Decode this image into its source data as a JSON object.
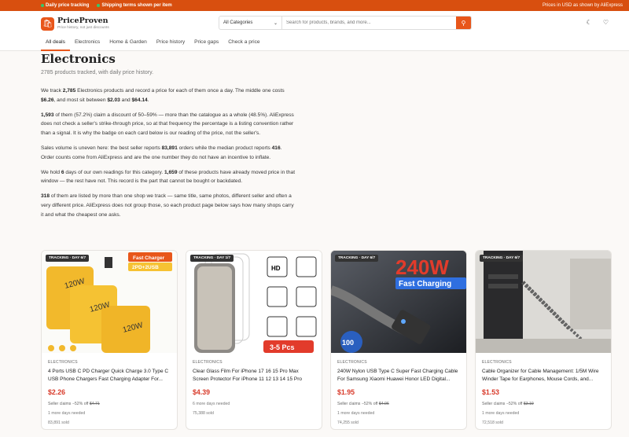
{
  "topbar": {
    "left": [
      "Daily price tracking",
      "Shipping terms shown per item"
    ],
    "right": "Prices in USD as shown by AliExpress"
  },
  "brand": {
    "name": "PriceProven",
    "tagline": "Price history, not just discounts"
  },
  "search": {
    "category": "All Categories",
    "placeholder": "Search for products, brands, and more..."
  },
  "nav": [
    "All deals",
    "Electronics",
    "Home & Garden",
    "Price history",
    "Price gaps",
    "Check a price"
  ],
  "page": {
    "title": "Electronics",
    "subtitle": "2785 products tracked, with daily price history."
  },
  "paragraphs": {
    "p1": {
      "a": "We track ",
      "b1": "2,785",
      "c": " Electronics products and record a price for each of them once a day. The middle one costs ",
      "b2": "$6.26",
      "d": ", and most sit between ",
      "b3": "$2.03",
      "e": " and ",
      "b4": "$64.14",
      "f": "."
    },
    "p2": {
      "b1": "1,593",
      "a": " of them (57.2%) claim a discount of 50–59% — more than the catalogue as a whole (48.5%). AliExpress does not check a seller's strike-through price, so at that frequency the percentage is a listing convention rather than a signal. It is why the badge on each card below is our reading of the price, not the seller's."
    },
    "p3": {
      "a": "Sales volume is uneven here: the best seller reports ",
      "b1": "83,891",
      "c": " orders while the median product reports ",
      "b2": "416",
      "d": ". Order counts come from AliExpress and are the one number they do not have an incentive to inflate."
    },
    "p4": {
      "a": "We hold ",
      "b1": "6",
      "c": " days of our own readings for this category. ",
      "b2": "1,659",
      "d": " of these products have already moved price in that window — the rest have not. This record is the part that cannot be bought or backdated."
    },
    "p5": {
      "b1": "318",
      "a": " of them are listed by more than one shop we track — same title, same photos, different seller and often a very different price. AliExpress does not group those, so each product page below says how many shops carry it and what the cheapest one asks."
    }
  },
  "cards": [
    {
      "badge": "TRACKING · DAY 6/7",
      "category": "ELECTRONICS",
      "title": "4 Ports USB C PD Charger Quick Charge 3.0 Type C USB Phone Chargers Fast Charging Adapter For...",
      "price": "$2.26",
      "claim_prefix": "Seller claims −52% off ",
      "claim_was": "$4.71",
      "days": "1 more days needed",
      "sold": "83,891 sold",
      "img_text1": "Fast Charger",
      "img_text2": "2PD+2USB",
      "img_text3": "120W"
    },
    {
      "badge": "TRACKING · DAY 1/7",
      "category": "ELECTRONICS",
      "title": "Clear Glass Film For iPhone 17 16 15 Pro Max Screen Protector For iPhone 11 12 13 14 15 Pro Tempered...",
      "price": "$4.39",
      "claim_prefix": "",
      "claim_was": "",
      "days": "6 more days needed",
      "sold": "75,388 sold",
      "img_text1": "HD",
      "img_text2": "3-5 Pcs"
    },
    {
      "badge": "TRACKING · DAY 6/7",
      "category": "ELECTRONICS",
      "title": "240W Nylon USB Type C Super Fast Charging Cable For Samsung Xiaomi Huawei Honor LED Digital...",
      "price": "$1.95",
      "claim_prefix": "Seller claims −52% off ",
      "claim_was": "$4.06",
      "days": "1 more days needed",
      "sold": "74,255 sold",
      "img_text1": "240W",
      "img_text2": "Fast Charging",
      "img_text3": "100"
    },
    {
      "badge": "TRACKING · DAY 6/7",
      "category": "ELECTRONICS",
      "title": "Cable Organizer for Cable Management: 1/5M Wire Winder Tape for Earphones, Mouse Cords, and...",
      "price": "$1.53",
      "claim_prefix": "Seller claims −52% off ",
      "claim_was": "$3.19",
      "days": "1 more days needed",
      "sold": "72,518 sold"
    }
  ]
}
